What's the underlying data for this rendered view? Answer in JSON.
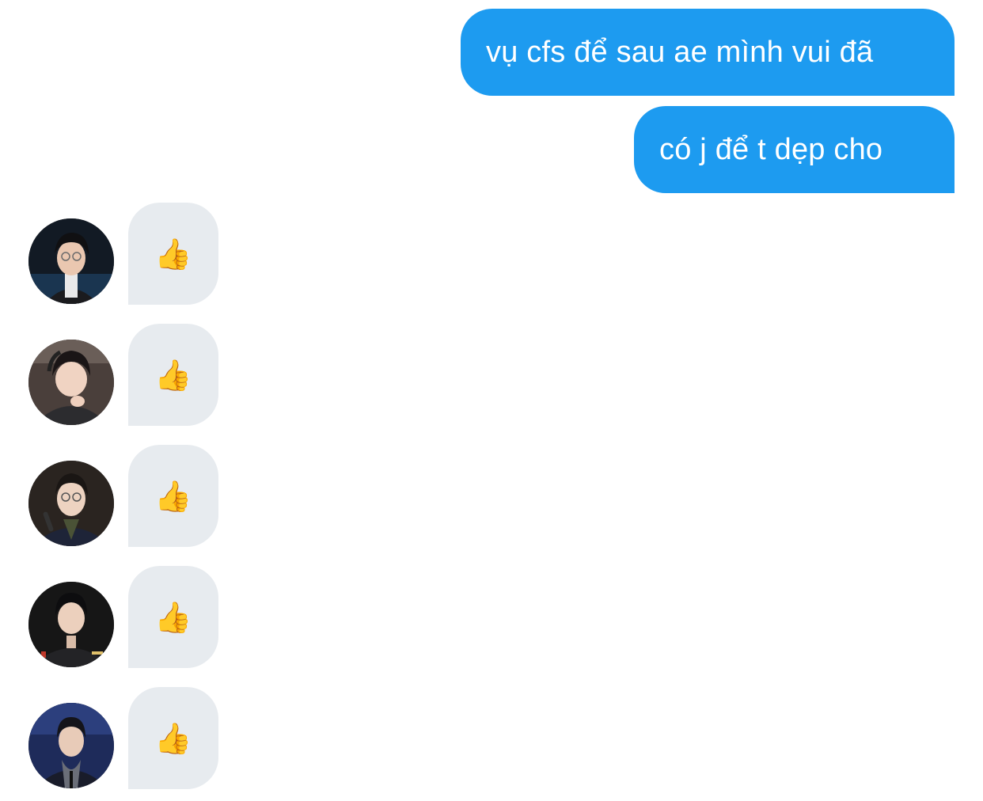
{
  "conversation": {
    "outgoing": [
      {
        "text": "vụ cfs để sau ae mình vui đã"
      },
      {
        "text": "có j để t dẹp cho"
      }
    ],
    "incoming": [
      {
        "reaction": "👍",
        "icon": "thumbs-up-icon"
      },
      {
        "reaction": "👍",
        "icon": "thumbs-up-icon"
      },
      {
        "reaction": "👍",
        "icon": "thumbs-up-icon"
      },
      {
        "reaction": "👍",
        "icon": "thumbs-up-icon"
      },
      {
        "reaction": "👍",
        "icon": "thumbs-up-icon"
      }
    ]
  },
  "colors": {
    "outgoing_bubble": "#1d9bf0",
    "incoming_bubble": "#e7ebef",
    "background": "#ffffff"
  }
}
